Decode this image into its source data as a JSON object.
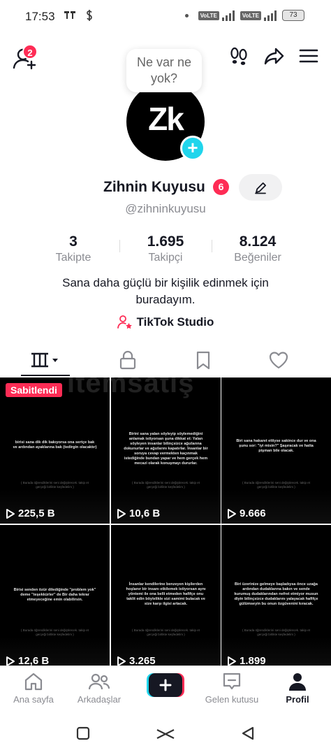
{
  "status_bar": {
    "time": "17:53",
    "battery": "73",
    "volte1": "VoLTE",
    "volte2": "VoLTE"
  },
  "header": {
    "friend_requests_badge": "2"
  },
  "profile": {
    "note": "Ne var ne yok?",
    "avatar_text": "Zk",
    "display_name": "Zihnin Kuyusu",
    "name_badge": "6",
    "username": "@zihninkuyusu",
    "bio_line1": "Sana daha güçlü bir kişilik edinmek için",
    "bio_line2": "buradayım.",
    "studio_link": "TikTok Studio"
  },
  "stats": [
    {
      "value": "3",
      "label": "Takipte"
    },
    {
      "value": "1.695",
      "label": "Takipçi"
    },
    {
      "value": "8.124",
      "label": "Beğeniler"
    }
  ],
  "tabs": [
    "videos-grid",
    "private",
    "saved",
    "liked"
  ],
  "videos": [
    {
      "pinned": "Sabitlendi",
      "views": "225,5 B",
      "text": "birisi sana dik dik bakıyorsa ona sertçe bak ve ardından ayaklarına bak (tedirgin olacaktır)",
      "footer": "( Burada öğrendiklerini seni değiştirecek. takip et gerçeği birlikte keşfedelim )"
    },
    {
      "pinned": "",
      "views": "10,6 B",
      "text": "Birini sana yalan söyleyip söylemediğini anlamak istiyorsan şuna dikkat et: Yalan söyleyen insanlar bilinçsizce ağızlarına dokunurlar ve ağızlarını kapatırlar. İnsanlar bir soruya cevap vermekten kaçınmak istediğinde bundan yapar ve hem gerçek hem mecazi olarak konuşmayı dururlar.",
      "footer": "( Burada öğrendiklerini seni değiştirecek. takip et gerçeği birlikte keşfedelim )"
    },
    {
      "pinned": "",
      "views": "9.666",
      "text": "Biri sana hakaret ettiyse sakince dur ve ona şunu sor: \"iyi misin?\" Şaşıracak ve hatta pişman bile olacak.",
      "footer": "( Burada öğrendiklerini seni değiştirecek. takip et gerçeği birlikte keşfedelim )"
    },
    {
      "pinned": "",
      "views": "12,6 B",
      "text": "Birisi senden özür dilediğinde \"problem yok\" deme \"teşekkürler\" de Bir daha tekrar etmeyeceğine emin olabilirsin.",
      "footer": "( Burada öğrendiklerini seni değiştirecek. takip et gerçeği birlikte keşfedelim )"
    },
    {
      "pinned": "",
      "views": "3.265",
      "text": "İnsanlar kendilerine benzeyen kişilerden hoşlanır bir insanı etkilemek istiyorsan aynı yöntemi ile ona belli etmeden hafifçe onu taklit edin böylelikle sizi samimi bulacak ve size karşı ilgisi artacak.",
      "footer": "( Burada öğrendiklerini seni değiştirecek. takip et gerçeği birlikte keşfedelim )"
    },
    {
      "pinned": "",
      "views": "1.899",
      "text": "Biri üzerinize gelmeye başladıysa önce uzağa ardından dudaklarına bakın ve sende kurumuş dudaklarından nefret etmiyor musun diyin bilinçsizce dudaklarını yalayacak hafifçe gülümseyin bu onun özgüvenini kıracak.",
      "footer": "( Burada öğrendiklerini seni değiştirecek. takip et gerçeği birlikte keşfedelim )"
    }
  ],
  "watermark": "itemsatış",
  "bottom_nav": [
    {
      "label": "Ana sayfa"
    },
    {
      "label": "Arkadaşlar"
    },
    {
      "label": ""
    },
    {
      "label": "Gelen kutusu"
    },
    {
      "label": "Profil"
    }
  ],
  "colors": {
    "accent": "#fe2c55",
    "cyan": "#20d5ec",
    "text": "#161823",
    "muted": "#8a8b91"
  }
}
